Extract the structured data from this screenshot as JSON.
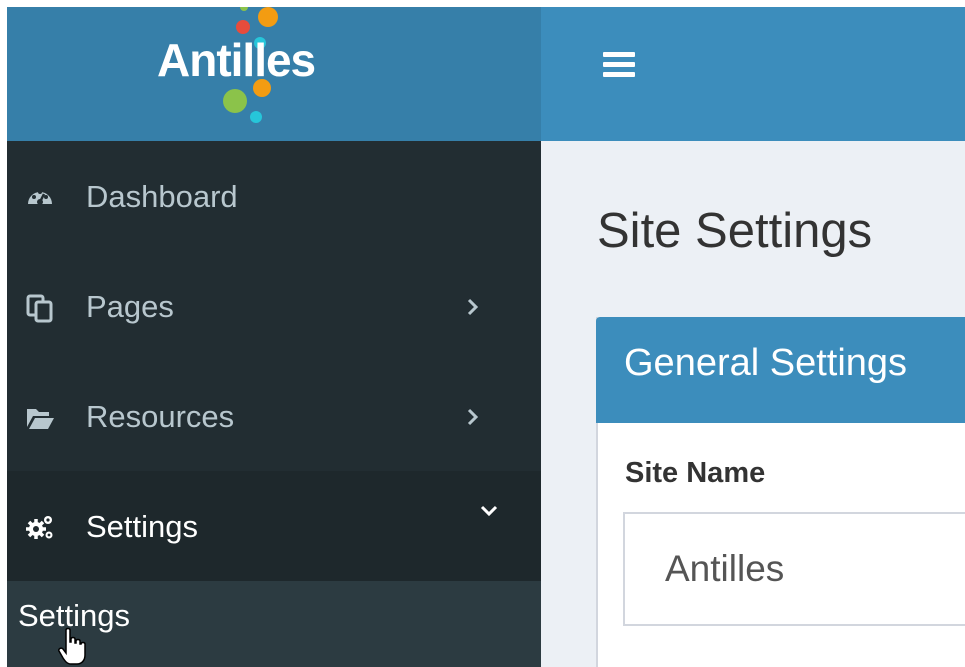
{
  "brand": {
    "name": "Antilles",
    "colors": {
      "logo_bg": "#367fa9",
      "topbar_bg": "#3c8dbc",
      "sidebar_bg": "#222d32",
      "sidebar_active_bg": "#1e282c",
      "submenu_bg": "#2c3b41",
      "content_bg": "#ecf0f5",
      "dot_orange": "#f39c12",
      "dot_red": "#e74c3c",
      "dot_green": "#8bc34a",
      "dot_cyan": "#26c6da"
    }
  },
  "header": {
    "menu_toggle_icon": "hamburger-icon"
  },
  "sidebar": {
    "items": [
      {
        "label": "Dashboard",
        "icon": "dashboard-icon",
        "has_children": false
      },
      {
        "label": "Pages",
        "icon": "pages-icon",
        "has_children": true,
        "expanded": false
      },
      {
        "label": "Resources",
        "icon": "folder-open-icon",
        "has_children": true,
        "expanded": false
      },
      {
        "label": "Settings",
        "icon": "cogs-icon",
        "has_children": true,
        "expanded": true
      }
    ],
    "submenu": [
      {
        "label": "Settings"
      }
    ]
  },
  "main": {
    "page_title": "Site Settings",
    "box": {
      "title": "General Settings",
      "fields": [
        {
          "label": "Site Name",
          "value": "Antilles"
        }
      ]
    }
  }
}
